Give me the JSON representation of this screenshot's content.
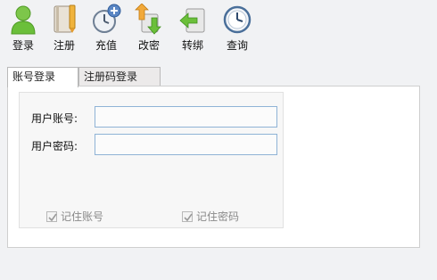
{
  "toolbar": {
    "items": [
      {
        "label": "登录",
        "icon": "user-icon"
      },
      {
        "label": "注册",
        "icon": "notebook-icon"
      },
      {
        "label": "充值",
        "icon": "clock-add-icon"
      },
      {
        "label": "改密",
        "icon": "swap-arrows-icon"
      },
      {
        "label": "转绑",
        "icon": "transfer-back-icon"
      },
      {
        "label": "查询",
        "icon": "clock-icon"
      }
    ]
  },
  "tabs": [
    {
      "label": "账号登录",
      "active": true
    },
    {
      "label": "注册码登录",
      "active": false
    }
  ],
  "form": {
    "account_label": "用户账号:",
    "account_value": "",
    "password_label": "用户密码:",
    "password_value": "",
    "remember_account_label": "记住账号",
    "remember_account_checked": true,
    "remember_password_label": "记住密码",
    "remember_password_checked": true
  },
  "colors": {
    "input_border": "#8fb3d6",
    "user_icon": "#6bbf3a",
    "clock_icon": "#4a6f9a"
  }
}
